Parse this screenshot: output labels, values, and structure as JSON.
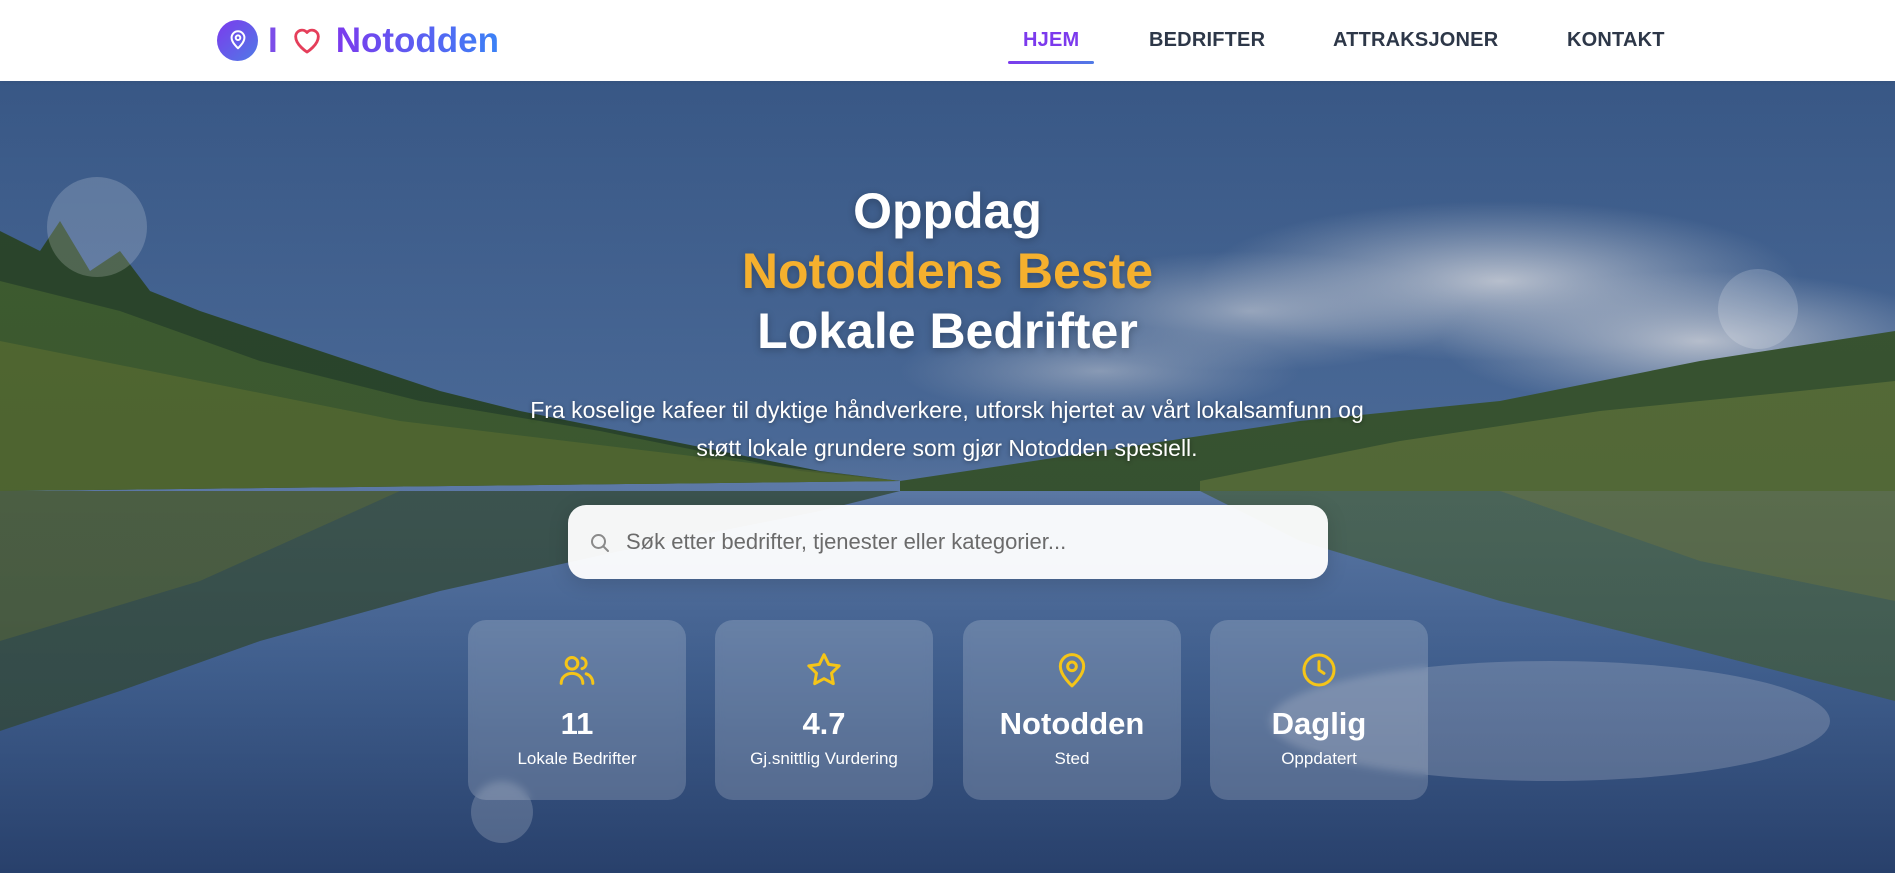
{
  "brand": {
    "prefix": "I",
    "name": "Notodden",
    "icon": "map-pin-icon",
    "heart_icon": "heart-icon",
    "colors": {
      "gradient_start": "#7c3aed",
      "gradient_end": "#3b82f6",
      "heart": "#e53e5a"
    }
  },
  "nav": {
    "items": [
      {
        "label": "HJEM",
        "active": true
      },
      {
        "label": "BEDRIFTER",
        "active": false
      },
      {
        "label": "ATTRAKSJONER",
        "active": false
      },
      {
        "label": "KONTAKT",
        "active": false
      }
    ],
    "active_color": "#7c3aed"
  },
  "hero": {
    "title_line1": "Oppdag",
    "title_line2": "Notoddens Beste",
    "title_line3": "Lokale Bedrifter",
    "accent_color": "#f5b02e",
    "subtitle_line1": "Fra koselige kafeer til dyktige håndverkere, utforsk hjertet av vårt lokalsamfunn og",
    "subtitle_line2": "støtt lokale grundere som gjør Notodden spesiell."
  },
  "search": {
    "placeholder": "Søk etter bedrifter, tjenester eller kategorier...",
    "value": "",
    "icon": "search-icon"
  },
  "stats": [
    {
      "icon": "users-icon",
      "value": "11",
      "label": "Lokale Bedrifter"
    },
    {
      "icon": "star-icon",
      "value": "4.7",
      "label": "Gj.snittlig Vurdering"
    },
    {
      "icon": "map-pin-icon",
      "value": "Notodden",
      "label": "Sted"
    },
    {
      "icon": "clock-icon",
      "value": "Daglig",
      "label": "Oppdatert"
    }
  ],
  "stat_icon_color": "#f5c518"
}
